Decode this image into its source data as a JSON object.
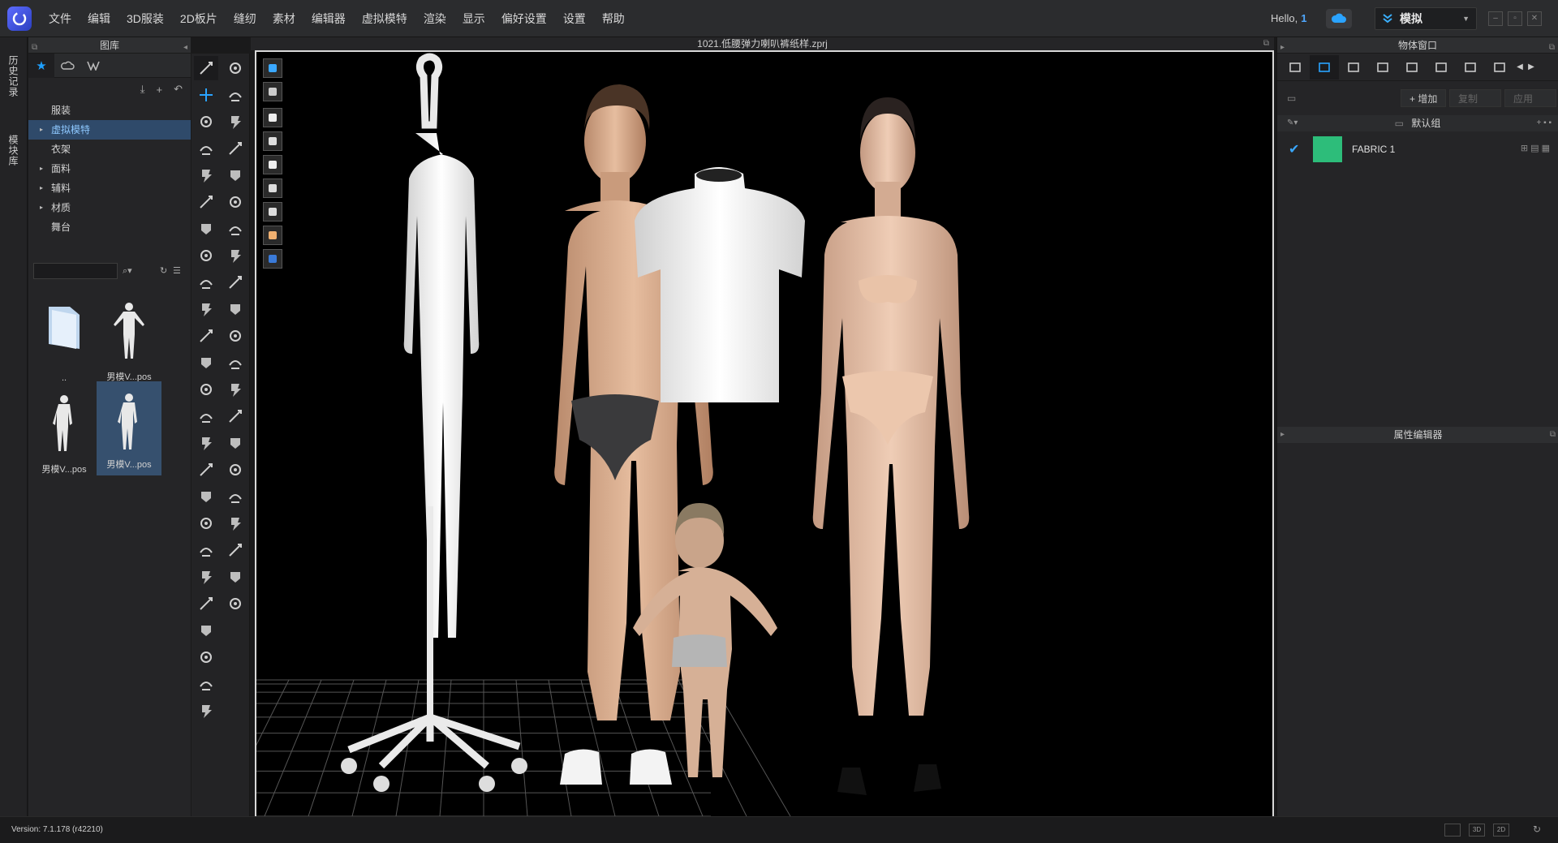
{
  "menu": [
    "文件",
    "编辑",
    "3D服装",
    "2D板片",
    "缝纫",
    "素材",
    "编辑器",
    "虚拟模特",
    "渲染",
    "显示",
    "偏好设置",
    "设置",
    "帮助"
  ],
  "user": {
    "greeting": "Hello,",
    "id": "1"
  },
  "mode": {
    "label": "模拟"
  },
  "window_buttons": [
    "–",
    "▫",
    "✕"
  ],
  "left_tabs": [
    "历史记录",
    "模块库"
  ],
  "library": {
    "title": "图库",
    "tree": [
      {
        "label": "服装",
        "arrow": ""
      },
      {
        "label": "虚拟模特",
        "arrow": "▸"
      },
      {
        "label": "衣架",
        "arrow": ""
      },
      {
        "label": "面料",
        "arrow": "▸"
      },
      {
        "label": "辅料",
        "arrow": "▸"
      },
      {
        "label": "材质",
        "arrow": "▸"
      },
      {
        "label": "舞台",
        "arrow": ""
      }
    ],
    "selected_tree_index": 1,
    "thumbnails": [
      {
        "caption": ".."
      },
      {
        "caption": "男模V...pos"
      },
      {
        "caption": "男模V...pos"
      },
      {
        "caption": "男模V...pos"
      }
    ]
  },
  "viewport": {
    "title": "1021.低腰弹力喇叭裤纸样.zprj"
  },
  "object_window": {
    "title": "物体窗口",
    "add_label": "增加",
    "copy_label": "复制",
    "apply_label": "应用",
    "group_label": "默认组",
    "fabric": {
      "name": "FABRIC 1",
      "color": "#2dbd7a"
    }
  },
  "property_editor": {
    "title": "属性编辑器"
  },
  "status": {
    "version": "Version: 7.1.178 (r42210)",
    "view_buttons": [
      "",
      "3D",
      "2D",
      "↻"
    ]
  },
  "colors": {
    "accent": "#1ea0ff",
    "selection": "#2f4a6a",
    "fabric": "#2dbd7a"
  }
}
